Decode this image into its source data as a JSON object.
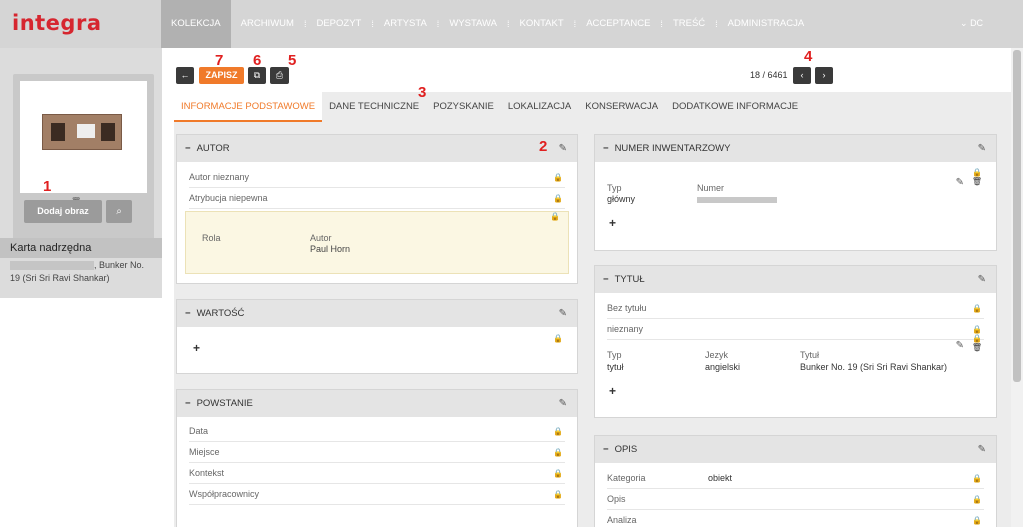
{
  "app": {
    "logo": "integra",
    "user": "DC",
    "user_caret": "⌄"
  },
  "nav": {
    "items": [
      "KOLEKCJA",
      "ARCHIWUM",
      "DEPOZYT",
      "ARTYSTA",
      "WYSTAWA",
      "KONTAKT",
      "ACCEPTANCE",
      "TREŚĆ",
      "ADMINISTRACJA"
    ],
    "separator": "⁞"
  },
  "sidebar": {
    "add_image_label": "Dodaj obraz",
    "trash_icon": "🗑",
    "comment_icon": "●",
    "search_icon": "⌕",
    "parent_title": "Karta nadrzędna",
    "parent_text_visible": ", Bunker No.",
    "parent_text_line2": "19 (Sri Sri Ravi Shankar)"
  },
  "toolbar": {
    "back": "←",
    "save": "ZAPISZ",
    "copy": "⧉",
    "print": "⎙",
    "counter": "18 / 6461",
    "prev": "‹",
    "next": "›"
  },
  "annotations": {
    "a1": "1",
    "a2": "2",
    "a3": "3",
    "a4": "4",
    "a5": "5",
    "a6": "6",
    "a7": "7"
  },
  "tabs": [
    "INFORMACJE PODSTAWOWE",
    "DANE TECHNICZNE",
    "POZYSKANIE",
    "LOKALIZACJA",
    "KONSERWACJA",
    "DODATKOWE INFORMACJE"
  ],
  "icons": {
    "minus": "−",
    "pencil": "✎",
    "lock": "🔒",
    "plus": "+",
    "trash": "🗑"
  },
  "autor": {
    "title": "AUTOR",
    "rows": [
      "Autor nieznany",
      "Atrybucja niepewna"
    ],
    "rola_label": "Rola",
    "autor_label": "Autor",
    "autor_value": "Paul Horn"
  },
  "wartosc": {
    "title": "WARTOŚĆ"
  },
  "powstanie": {
    "title": "POWSTANIE",
    "rows": [
      "Data",
      "Miejsce",
      "Kontekst",
      "Współpracownicy"
    ]
  },
  "numer": {
    "title": "NUMER INWENTARZOWY",
    "typ_label": "Typ",
    "typ_value": "główny",
    "numer_label": "Numer"
  },
  "tytul": {
    "title": "TYTUŁ",
    "rows": [
      "Bez tytułu",
      "nieznany"
    ],
    "typ_label": "Typ",
    "typ_value": "tytuł",
    "jezyk_label": "Jezyk",
    "jezyk_value": "angielski",
    "tytul_label": "Tytuł",
    "tytul_value": "Bunker No. 19 (Sri Sri Ravi Shankar)"
  },
  "opis": {
    "title": "OPIS",
    "rows": [
      {
        "label": "Kategoria",
        "value": "obiekt"
      },
      {
        "label": "Opis",
        "value": ""
      },
      {
        "label": "Analiza",
        "value": ""
      }
    ]
  }
}
